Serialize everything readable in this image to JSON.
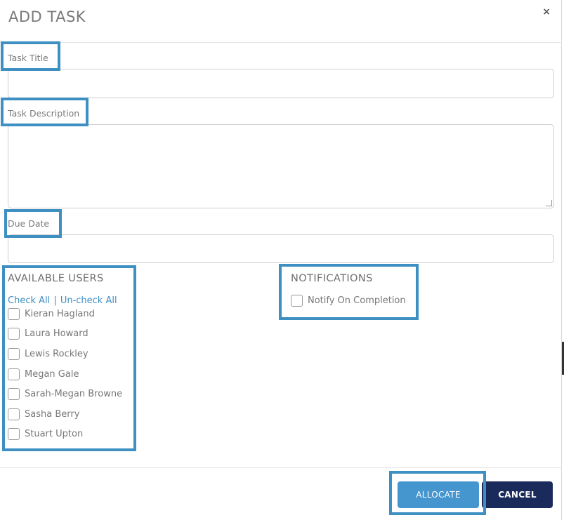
{
  "dialog": {
    "title": "ADD TASK",
    "close_glyph": "×"
  },
  "form": {
    "title_label": "Task Title",
    "title_value": "",
    "description_label": "Task Description",
    "description_value": "",
    "due_date_label": "Due Date",
    "due_date_value": ""
  },
  "users": {
    "heading": "AVAILABLE USERS",
    "check_all": "Check All",
    "separator": "|",
    "uncheck_all": "Un-check All",
    "list": [
      {
        "name": "Kieran Hagland",
        "checked": false
      },
      {
        "name": "Laura Howard",
        "checked": false
      },
      {
        "name": "Lewis Rockley",
        "checked": false
      },
      {
        "name": "Megan Gale",
        "checked": false
      },
      {
        "name": "Sarah-Megan Browne",
        "checked": false
      },
      {
        "name": "Sasha Berry",
        "checked": false
      },
      {
        "name": "Stuart Upton",
        "checked": false
      }
    ]
  },
  "notifications": {
    "heading": "NOTIFICATIONS",
    "notify_label": "Notify On Completion",
    "notify_checked": false
  },
  "footer": {
    "allocate_label": "ALLOCATE",
    "cancel_label": "CANCEL"
  },
  "colors": {
    "annotation": "#3e90c2",
    "allocate": "#4596cf",
    "cancel": "#1a2a5a",
    "link": "#3e8ec4"
  }
}
